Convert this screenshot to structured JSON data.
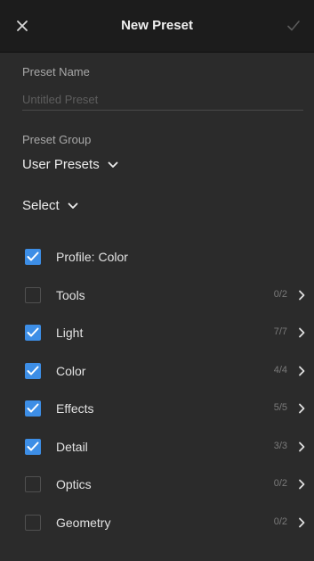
{
  "header": {
    "title": "New Preset",
    "close_icon": "close-icon",
    "confirm_icon": "checkmark-icon"
  },
  "preset_name": {
    "label": "Preset Name",
    "value": "",
    "placeholder": "Untitled Preset"
  },
  "preset_group": {
    "label": "Preset Group",
    "value": "User Presets"
  },
  "select_menu": {
    "label": "Select"
  },
  "settings": [
    {
      "label": "Profile: Color",
      "checked": true,
      "count": "",
      "has_arrow": false
    },
    {
      "label": "Tools",
      "checked": false,
      "count": "0/2",
      "has_arrow": true
    },
    {
      "label": "Light",
      "checked": true,
      "count": "7/7",
      "has_arrow": true
    },
    {
      "label": "Color",
      "checked": true,
      "count": "4/4",
      "has_arrow": true
    },
    {
      "label": "Effects",
      "checked": true,
      "count": "5/5",
      "has_arrow": true
    },
    {
      "label": "Detail",
      "checked": true,
      "count": "3/3",
      "has_arrow": true
    },
    {
      "label": "Optics",
      "checked": false,
      "count": "0/2",
      "has_arrow": true
    },
    {
      "label": "Geometry",
      "checked": false,
      "count": "0/2",
      "has_arrow": true
    }
  ],
  "colors": {
    "accent": "#3d8ee6",
    "header_bg": "#1c1c1c",
    "panel_bg": "#2b2b2b"
  }
}
